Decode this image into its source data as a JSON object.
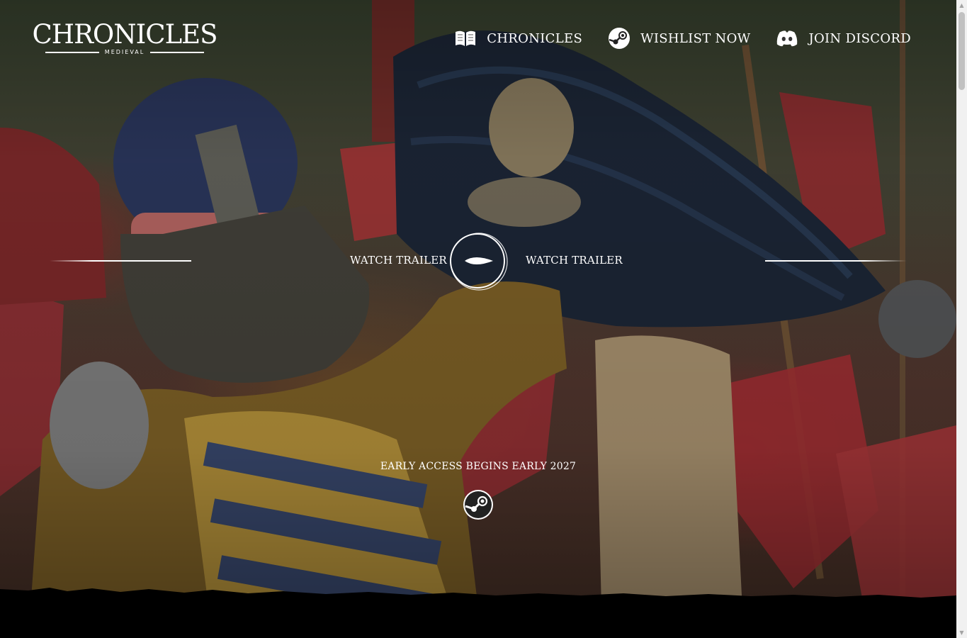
{
  "brand": {
    "logo_text": "CHRONICLES",
    "logo_subtitle": "MEDIEVAL"
  },
  "nav": {
    "items": [
      {
        "label": "CHRONICLES",
        "icon": "book-icon"
      },
      {
        "label": "WISHLIST NOW",
        "icon": "steam-icon"
      },
      {
        "label": "JOIN DISCORD",
        "icon": "discord-icon"
      }
    ]
  },
  "trailer": {
    "left_label": "WATCH TRAILER",
    "right_label": "WATCH TRAILER",
    "play_icon": "play-icon"
  },
  "early_access": {
    "text": "EARLY ACCESS BEGINS EARLY 2027",
    "button_icon": "steam-icon"
  },
  "colors": {
    "text": "#ffffff",
    "footer_band": "#000000"
  }
}
